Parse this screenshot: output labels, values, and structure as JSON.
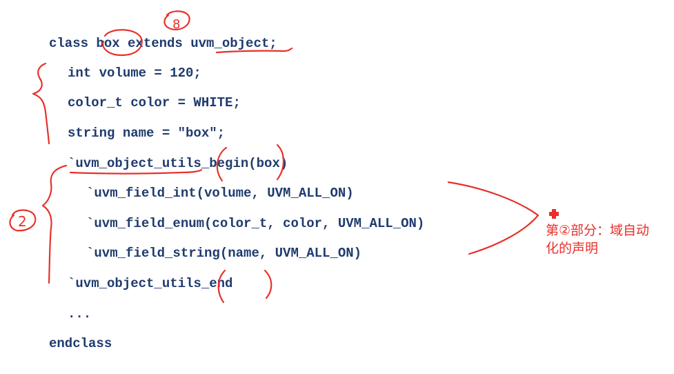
{
  "code": {
    "lines": [
      "class box extends uvm_object;",
      "int volume = 120;",
      "color_t color = WHITE;",
      "string name = \"box\";",
      "`uvm_object_utils_begin(box)",
      "`uvm_field_int(volume, UVM_ALL_ON)",
      "`uvm_field_enum(color_t, color, UVM_ALL_ON)",
      "`uvm_field_string(name, UVM_ALL_ON)",
      "`uvm_object_utils_end",
      "...",
      "endclass"
    ]
  },
  "annotation": {
    "note_line1": "第②部分：域自动",
    "note_line2": "化的声明",
    "mark_top": "8",
    "mark_left": "2"
  },
  "colors": {
    "code": "#1f3b6e",
    "ink": "#e8302a"
  }
}
